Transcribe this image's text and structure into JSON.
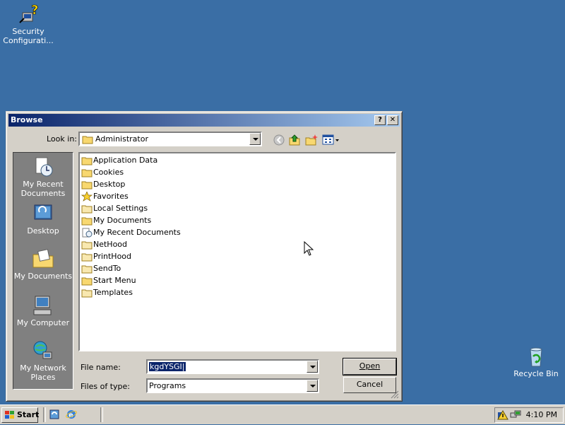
{
  "desktop": {
    "security_icon_label": "Security Configurati...",
    "recycle_bin_label": "Recycle Bin"
  },
  "dialog": {
    "title": "Browse",
    "help_button": "?",
    "close_button": "✕",
    "look_in_label": "Look in:",
    "look_in_value": "Administrator",
    "places": [
      {
        "label": "My Recent Documents",
        "icon": "recent-documents-icon"
      },
      {
        "label": "Desktop",
        "icon": "desktop-icon"
      },
      {
        "label": "My Documents",
        "icon": "my-documents-icon"
      },
      {
        "label": "My Computer",
        "icon": "my-computer-icon"
      },
      {
        "label": "My Network Places",
        "icon": "network-places-icon"
      }
    ],
    "files": [
      {
        "name": "Application Data",
        "icon": "folder-icon"
      },
      {
        "name": "Cookies",
        "icon": "folder-icon"
      },
      {
        "name": "Desktop",
        "icon": "folder-icon"
      },
      {
        "name": "Favorites",
        "icon": "star-icon"
      },
      {
        "name": "Local Settings",
        "icon": "folder-icon"
      },
      {
        "name": "My Documents",
        "icon": "folder-icon"
      },
      {
        "name": "My Recent Documents",
        "icon": "recent-documents-icon"
      },
      {
        "name": "NetHood",
        "icon": "folder-icon"
      },
      {
        "name": "PrintHood",
        "icon": "folder-icon"
      },
      {
        "name": "SendTo",
        "icon": "folder-icon"
      },
      {
        "name": "Start Menu",
        "icon": "folder-icon"
      },
      {
        "name": "Templates",
        "icon": "folder-icon"
      }
    ],
    "file_name_label": "File name:",
    "file_name_value": "kgdYSGI|",
    "file_type_label": "Files of type:",
    "file_type_value": "Programs",
    "open_button": "Open",
    "cancel_button": "Cancel"
  },
  "taskbar": {
    "start_label": "Start",
    "clock": "4:10 PM"
  },
  "colors": {
    "desktop": "#3A6EA5",
    "window": "#D4D0C8",
    "title_start": "#0A246A",
    "title_end": "#A6CAF0",
    "selection": "#0A246A"
  }
}
